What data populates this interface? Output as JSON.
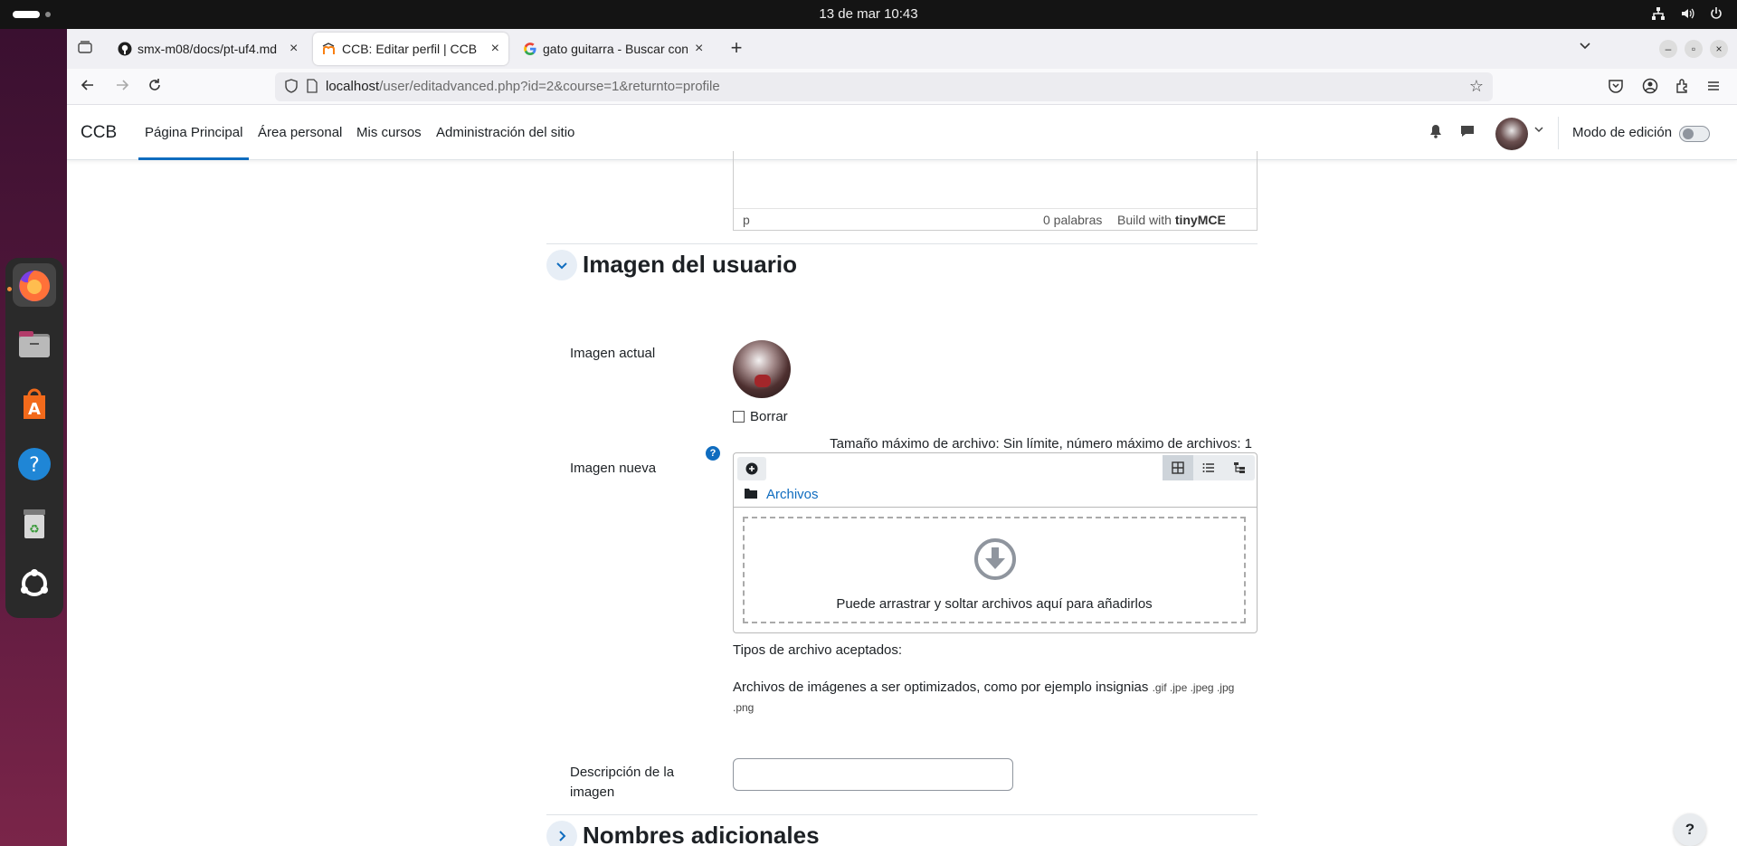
{
  "system": {
    "clock": "13 de mar  10:43",
    "tray_icons": [
      "network-icon",
      "volume-icon",
      "power-icon"
    ]
  },
  "dock": {
    "items": [
      "firefox-icon",
      "files-icon",
      "app-center-icon",
      "help-icon",
      "trash-icon",
      "ubuntu-apps-icon"
    ]
  },
  "browser": {
    "tabs": [
      {
        "title": "smx-m08/docs/pt-uf4.md",
        "favicon": "github-icon"
      },
      {
        "title": "CCB: Editar perfil | CCB",
        "favicon": "moodle-icon",
        "active": true
      },
      {
        "title": "gato guitarra - Buscar con Google",
        "favicon": "google-icon"
      }
    ],
    "url_host": "localhost",
    "url_path": "/user/editadvanced.php?id=2&course=1&returnto=profile"
  },
  "moodle": {
    "brand": "CCB",
    "nav": {
      "home": "Página Principal",
      "dashboard": "Área personal",
      "my_courses": "Mis cursos",
      "site_admin": "Administración del sitio"
    },
    "edit_mode_label": "Modo de edición"
  },
  "editor": {
    "path": "p",
    "word_count": "0 palabras",
    "built_with": "Build with",
    "tiny_brand": "tinyMCE"
  },
  "section_picture": {
    "title": "Imagen del usuario",
    "current_label": "Imagen actual",
    "delete_label": "Borrar",
    "new_label": "Imagen nueva",
    "max_size": "Tamaño máximo de archivo: Sin límite, número máximo de archivos: 1",
    "folder_label": "Archivos",
    "drop_text": "Puede arrastrar y soltar archivos aquí para añadirlos",
    "accepted_types_label": "Tipos de archivo aceptados:",
    "accepted_types_desc": "Archivos de imágenes a ser optimizados, como por ejemplo insignias",
    "accepted_types_ext": ".gif .jpe .jpeg .jpg",
    "accepted_types_ext2": ".png",
    "description_label": "Descripción de la imagen",
    "description_value": ""
  },
  "section_names": {
    "title": "Nombres adicionales"
  },
  "help_button": "?"
}
